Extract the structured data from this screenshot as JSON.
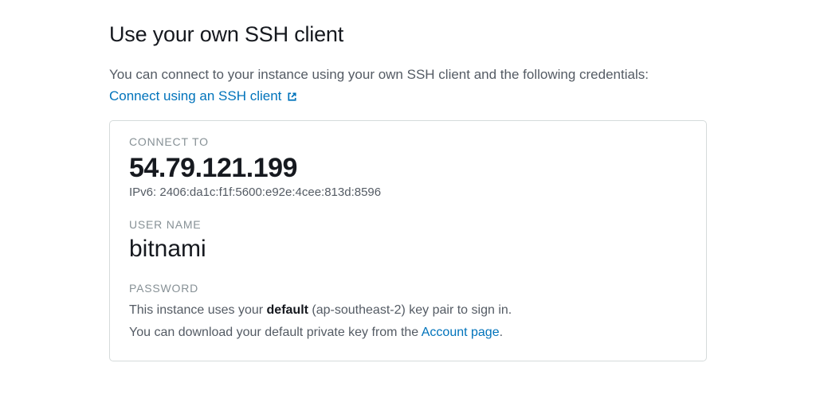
{
  "title": "Use your own SSH client",
  "description": "You can connect to your instance using your own SSH client and the following credentials:",
  "ssh_link_text": "Connect using an SSH client",
  "card": {
    "connect_label": "CONNECT TO",
    "ipv4": "54.79.121.199",
    "ipv6_prefix": "IPv6: ",
    "ipv6": "2406:da1c:f1f:5600:e92e:4cee:813d:8596",
    "username_label": "USER NAME",
    "username": "bitnami",
    "password_label": "PASSWORD",
    "password_line1_pre": "This instance uses your ",
    "password_line1_bold": "default",
    "password_line1_post": " (ap-southeast-2) key pair to sign in.",
    "password_line2_pre": "You can download your default private key from the ",
    "password_line2_link": "Account page",
    "password_line2_post": "."
  }
}
